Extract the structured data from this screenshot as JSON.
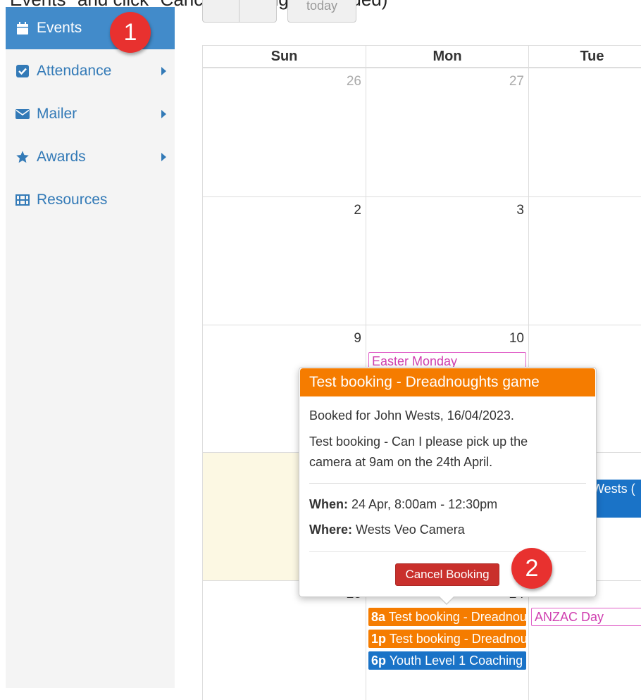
{
  "caption": "Events\" and click \"Cancel Booking\" (if needed)",
  "sidebar": {
    "items": [
      {
        "label": "Events",
        "icon": "calendar-icon",
        "active": true
      },
      {
        "label": "Attendance",
        "icon": "checkbox-icon",
        "has_submenu": true
      },
      {
        "label": "Mailer",
        "icon": "envelope-icon",
        "has_submenu": true
      },
      {
        "label": "Awards",
        "icon": "star-icon",
        "has_submenu": true
      },
      {
        "label": "Resources",
        "icon": "film-icon"
      }
    ]
  },
  "annotations": {
    "step1": "1",
    "step2": "2"
  },
  "toolbar": {
    "today_label": "today"
  },
  "calendar": {
    "headers": [
      "Sun",
      "Mon",
      "Tue"
    ],
    "weeks": [
      {
        "days": [
          "26",
          "27",
          ""
        ]
      },
      {
        "days": [
          "2",
          "3",
          ""
        ]
      },
      {
        "days": [
          "9",
          "10",
          ""
        ]
      },
      {
        "days": [
          "",
          "",
          ""
        ]
      },
      {
        "days": [
          "23",
          "24",
          ""
        ]
      }
    ],
    "events": {
      "easter_monday": "Easter Monday",
      "partial_wests": "y Wests (",
      "anzac_day": "ANZAC Day",
      "ev1_time": "8a",
      "ev1_title": "Test booking - Dreadnoughts game",
      "ev2_time": "1p",
      "ev2_title": "Test booking - Dreadnoughts game",
      "ev3_time": "6p",
      "ev3_title": "Youth Level 1 Coaching"
    }
  },
  "popover": {
    "title": "Test booking - Dreadnoughts game",
    "booked_for": "Booked for John Wests, 16/04/2023.",
    "description_line1": "Test booking - Can I please pick up the",
    "description_line2": "camera at 9am on the 24th April.",
    "when_label": "When:",
    "when_value": "24 Apr, 8:00am - 12:30pm",
    "where_label": "Where:",
    "where_value": "Wests Veo Camera",
    "cancel_label": "Cancel Booking"
  },
  "colors": {
    "accent": "#428bca",
    "orange": "#f57c00",
    "danger": "#c9302c",
    "today_bg": "#fcf8e3",
    "badge": "#e8312f"
  }
}
